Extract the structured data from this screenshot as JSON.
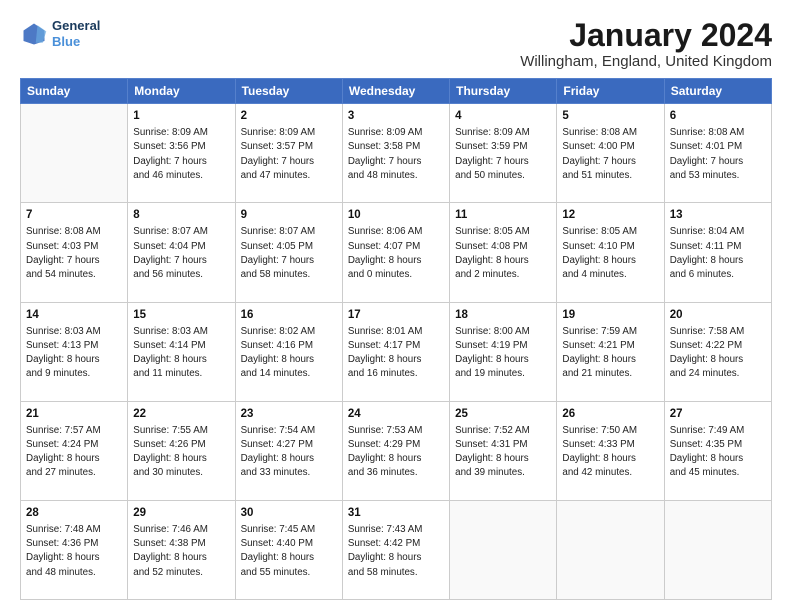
{
  "header": {
    "logo_line1": "General",
    "logo_line2": "Blue",
    "month_title": "January 2024",
    "location": "Willingham, England, United Kingdom"
  },
  "days_of_week": [
    "Sunday",
    "Monday",
    "Tuesday",
    "Wednesday",
    "Thursday",
    "Friday",
    "Saturday"
  ],
  "weeks": [
    [
      {
        "day": "",
        "info": ""
      },
      {
        "day": "1",
        "info": "Sunrise: 8:09 AM\nSunset: 3:56 PM\nDaylight: 7 hours\nand 46 minutes."
      },
      {
        "day": "2",
        "info": "Sunrise: 8:09 AM\nSunset: 3:57 PM\nDaylight: 7 hours\nand 47 minutes."
      },
      {
        "day": "3",
        "info": "Sunrise: 8:09 AM\nSunset: 3:58 PM\nDaylight: 7 hours\nand 48 minutes."
      },
      {
        "day": "4",
        "info": "Sunrise: 8:09 AM\nSunset: 3:59 PM\nDaylight: 7 hours\nand 50 minutes."
      },
      {
        "day": "5",
        "info": "Sunrise: 8:08 AM\nSunset: 4:00 PM\nDaylight: 7 hours\nand 51 minutes."
      },
      {
        "day": "6",
        "info": "Sunrise: 8:08 AM\nSunset: 4:01 PM\nDaylight: 7 hours\nand 53 minutes."
      }
    ],
    [
      {
        "day": "7",
        "info": "Sunrise: 8:08 AM\nSunset: 4:03 PM\nDaylight: 7 hours\nand 54 minutes."
      },
      {
        "day": "8",
        "info": "Sunrise: 8:07 AM\nSunset: 4:04 PM\nDaylight: 7 hours\nand 56 minutes."
      },
      {
        "day": "9",
        "info": "Sunrise: 8:07 AM\nSunset: 4:05 PM\nDaylight: 7 hours\nand 58 minutes."
      },
      {
        "day": "10",
        "info": "Sunrise: 8:06 AM\nSunset: 4:07 PM\nDaylight: 8 hours\nand 0 minutes."
      },
      {
        "day": "11",
        "info": "Sunrise: 8:05 AM\nSunset: 4:08 PM\nDaylight: 8 hours\nand 2 minutes."
      },
      {
        "day": "12",
        "info": "Sunrise: 8:05 AM\nSunset: 4:10 PM\nDaylight: 8 hours\nand 4 minutes."
      },
      {
        "day": "13",
        "info": "Sunrise: 8:04 AM\nSunset: 4:11 PM\nDaylight: 8 hours\nand 6 minutes."
      }
    ],
    [
      {
        "day": "14",
        "info": "Sunrise: 8:03 AM\nSunset: 4:13 PM\nDaylight: 8 hours\nand 9 minutes."
      },
      {
        "day": "15",
        "info": "Sunrise: 8:03 AM\nSunset: 4:14 PM\nDaylight: 8 hours\nand 11 minutes."
      },
      {
        "day": "16",
        "info": "Sunrise: 8:02 AM\nSunset: 4:16 PM\nDaylight: 8 hours\nand 14 minutes."
      },
      {
        "day": "17",
        "info": "Sunrise: 8:01 AM\nSunset: 4:17 PM\nDaylight: 8 hours\nand 16 minutes."
      },
      {
        "day": "18",
        "info": "Sunrise: 8:00 AM\nSunset: 4:19 PM\nDaylight: 8 hours\nand 19 minutes."
      },
      {
        "day": "19",
        "info": "Sunrise: 7:59 AM\nSunset: 4:21 PM\nDaylight: 8 hours\nand 21 minutes."
      },
      {
        "day": "20",
        "info": "Sunrise: 7:58 AM\nSunset: 4:22 PM\nDaylight: 8 hours\nand 24 minutes."
      }
    ],
    [
      {
        "day": "21",
        "info": "Sunrise: 7:57 AM\nSunset: 4:24 PM\nDaylight: 8 hours\nand 27 minutes."
      },
      {
        "day": "22",
        "info": "Sunrise: 7:55 AM\nSunset: 4:26 PM\nDaylight: 8 hours\nand 30 minutes."
      },
      {
        "day": "23",
        "info": "Sunrise: 7:54 AM\nSunset: 4:27 PM\nDaylight: 8 hours\nand 33 minutes."
      },
      {
        "day": "24",
        "info": "Sunrise: 7:53 AM\nSunset: 4:29 PM\nDaylight: 8 hours\nand 36 minutes."
      },
      {
        "day": "25",
        "info": "Sunrise: 7:52 AM\nSunset: 4:31 PM\nDaylight: 8 hours\nand 39 minutes."
      },
      {
        "day": "26",
        "info": "Sunrise: 7:50 AM\nSunset: 4:33 PM\nDaylight: 8 hours\nand 42 minutes."
      },
      {
        "day": "27",
        "info": "Sunrise: 7:49 AM\nSunset: 4:35 PM\nDaylight: 8 hours\nand 45 minutes."
      }
    ],
    [
      {
        "day": "28",
        "info": "Sunrise: 7:48 AM\nSunset: 4:36 PM\nDaylight: 8 hours\nand 48 minutes."
      },
      {
        "day": "29",
        "info": "Sunrise: 7:46 AM\nSunset: 4:38 PM\nDaylight: 8 hours\nand 52 minutes."
      },
      {
        "day": "30",
        "info": "Sunrise: 7:45 AM\nSunset: 4:40 PM\nDaylight: 8 hours\nand 55 minutes."
      },
      {
        "day": "31",
        "info": "Sunrise: 7:43 AM\nSunset: 4:42 PM\nDaylight: 8 hours\nand 58 minutes."
      },
      {
        "day": "",
        "info": ""
      },
      {
        "day": "",
        "info": ""
      },
      {
        "day": "",
        "info": ""
      }
    ]
  ]
}
